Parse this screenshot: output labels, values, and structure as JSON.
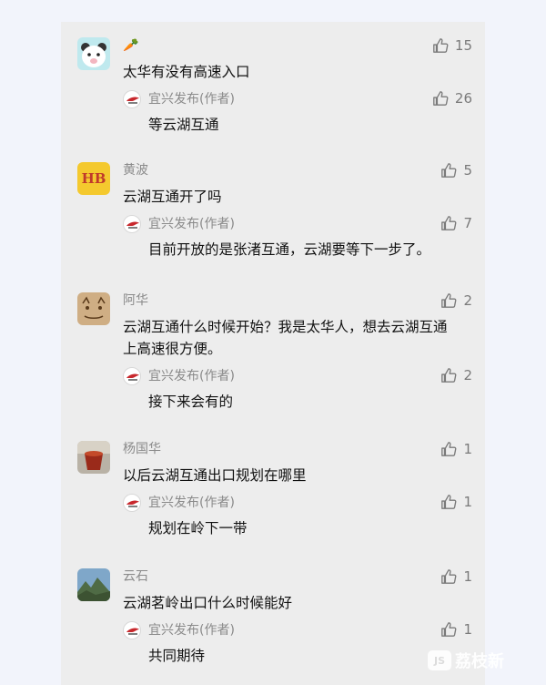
{
  "comments": [
    {
      "user": "🥕",
      "text": "太华有没有高速入口",
      "likes": "15",
      "reply": {
        "author": "宜兴发布(作者)",
        "text": "等云湖互通",
        "likes": "26"
      }
    },
    {
      "user": "黄波",
      "avatar_text": "HB",
      "text": "云湖互通开了吗",
      "likes": "5",
      "reply": {
        "author": "宜兴发布(作者)",
        "text": "目前开放的是张渚互通，云湖要等下一步了。",
        "likes": "7"
      }
    },
    {
      "user": "阿华",
      "text": "云湖互通什么时候开始？我是太华人，想去云湖互通上高速很方便。",
      "likes": "2",
      "reply": {
        "author": "宜兴发布(作者)",
        "text": "接下来会有的",
        "likes": "2"
      }
    },
    {
      "user": "杨国华",
      "text": "以后云湖互通出口规划在哪里",
      "likes": "1",
      "reply": {
        "author": "宜兴发布(作者)",
        "text": "规划在岭下一带",
        "likes": "1"
      }
    },
    {
      "user": "云石",
      "text": "云湖茗岭出口什么时候能好",
      "likes": "1",
      "reply": {
        "author": "宜兴发布(作者)",
        "text": "共同期待",
        "likes": "1"
      }
    }
  ],
  "watermark": {
    "badge": "JS",
    "text": "荔枝新"
  },
  "icons": {
    "like": "thumbs-up-icon"
  },
  "colors": {
    "panel": "#ededed",
    "meta": "#8a8a8a",
    "text": "#111111"
  }
}
